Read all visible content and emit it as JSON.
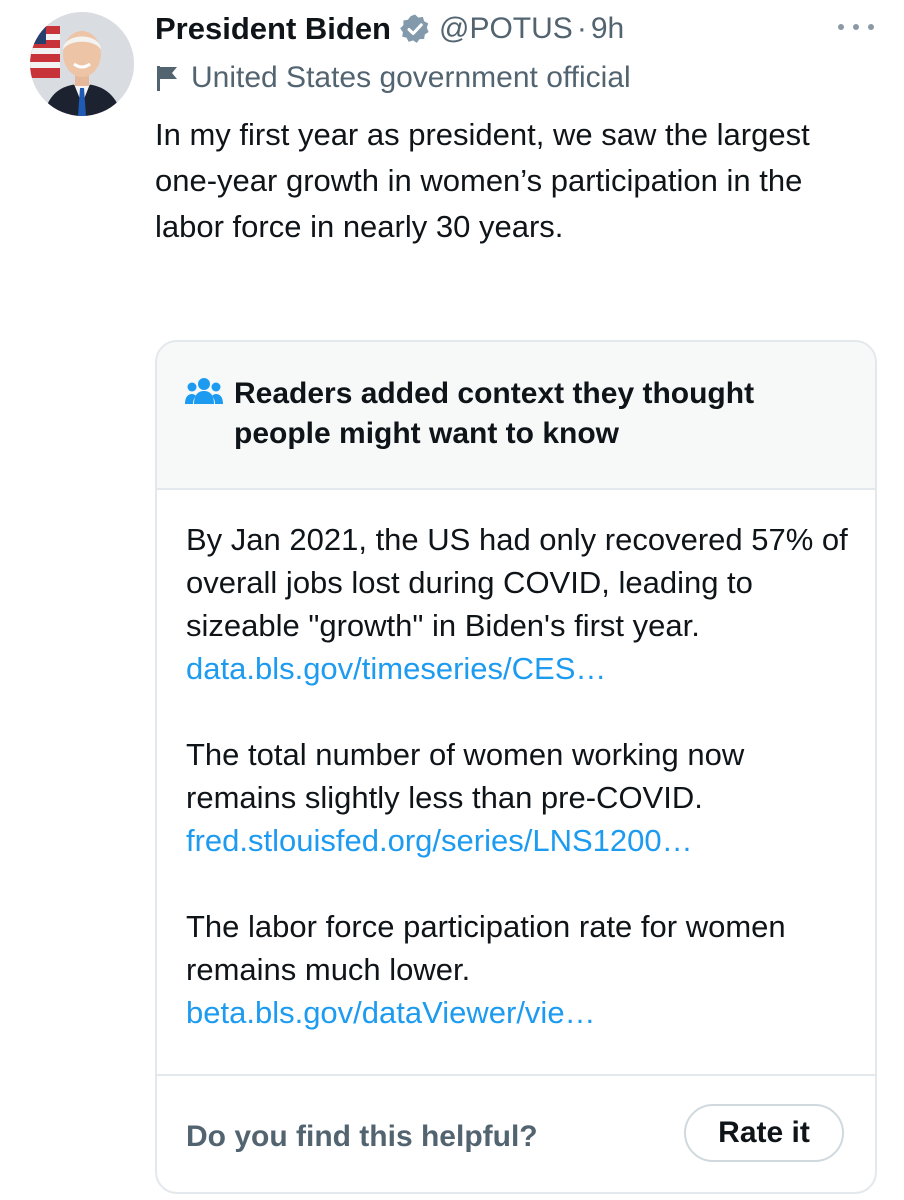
{
  "author": {
    "name": "President Biden",
    "handle": "@POTUS",
    "separator": "·",
    "time": "9h",
    "label": "United States government official"
  },
  "tweet": {
    "text": "In my first year as president, we saw the largest one-year growth in women’s participation in the labor force in nearly 30 years."
  },
  "community_note": {
    "title": "Readers added context they thought people might want to know",
    "paragraphs": [
      {
        "text": "By Jan 2021, the US had only recovered 57% of overall jobs lost during COVID, leading to sizeable \"growth\" in Biden's first year.",
        "link": "data.bls.gov/timeseries/CES…"
      },
      {
        "text": "The total number of women working now remains slightly less than pre-COVID.",
        "link": "fred.stlouisfed.org/series/LNS1200…"
      },
      {
        "text": "The labor force participation rate for women remains much lower.",
        "link": "beta.bls.gov/dataViewer/vie…"
      }
    ],
    "helpful_prompt": "Do you find this helpful?",
    "rate_button": "Rate it"
  },
  "colors": {
    "text_primary": "#0f1419",
    "text_secondary": "#536471",
    "link": "#1d9bf0",
    "border": "#e3e8ec",
    "note_header_bg": "#f7f9f9",
    "verified_badge": "#829aab"
  },
  "icons": {
    "verified": "verified-badge-icon",
    "label": "flag-icon",
    "note": "people-icon",
    "menu": "more-options-icon"
  }
}
